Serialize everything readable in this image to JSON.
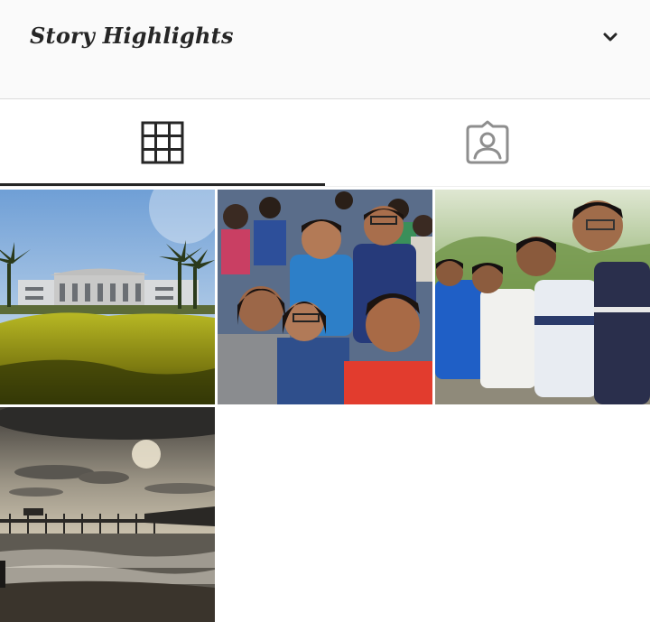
{
  "highlights": {
    "title": "Story Highlights",
    "toggle_icon": "chevron-down-icon"
  },
  "tabs": [
    {
      "id": "posts",
      "icon": "grid-icon",
      "active": true
    },
    {
      "id": "tagged",
      "icon": "tagged-user-icon",
      "active": false
    }
  ],
  "photos": [
    {
      "id": "campus-building",
      "subject": "campus building with palm trees and yellow hedge"
    },
    {
      "id": "group-selfie-crowd",
      "subject": "group selfie of friends in a crowd"
    },
    {
      "id": "four-friends",
      "subject": "four friends posing outdoors"
    },
    {
      "id": "sunset-pier",
      "subject": "cloudy sunset over sea with pier"
    }
  ],
  "colors": {
    "header_bg": "#fafafa",
    "text": "#262626",
    "icon_inactive": "#8e8e8e",
    "divider": "#dbdbdb"
  }
}
